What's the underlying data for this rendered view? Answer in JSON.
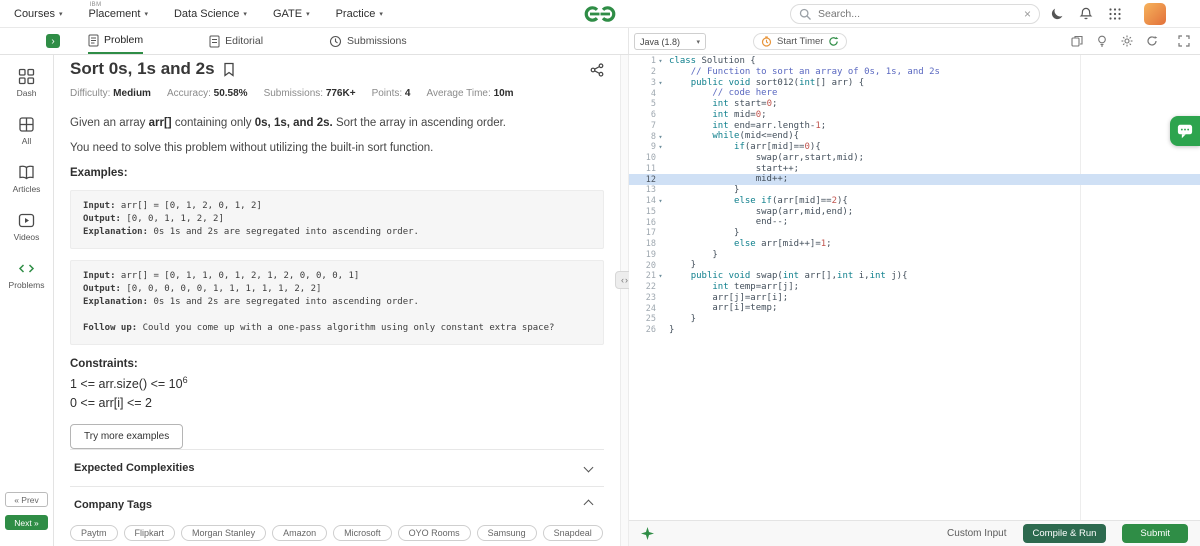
{
  "navbar": {
    "links": [
      {
        "label": "Courses"
      },
      {
        "label": "Placement",
        "badge": "IBM"
      },
      {
        "label": "Data Science"
      },
      {
        "label": "GATE"
      },
      {
        "label": "Practice"
      }
    ],
    "search": {
      "placeholder": "Search...",
      "clear": "×"
    }
  },
  "tabbar": {
    "tabs": [
      {
        "label": "Problem"
      },
      {
        "label": "Editorial"
      },
      {
        "label": "Submissions"
      }
    ],
    "language": "Java (1.8)",
    "timer_label": "Start Timer"
  },
  "siderail": {
    "items": [
      {
        "label": "Dash"
      },
      {
        "label": "All"
      },
      {
        "label": "Articles"
      },
      {
        "label": "Videos"
      },
      {
        "label": "Problems"
      }
    ],
    "prev_label": "« Prev",
    "next_label": "Next »"
  },
  "problem": {
    "title": "Sort 0s, 1s and 2s",
    "stats": [
      {
        "label": "Difficulty:",
        "value": "Medium"
      },
      {
        "label": "Accuracy:",
        "value": "50.58%"
      },
      {
        "label": "Submissions:",
        "value": "776K+"
      },
      {
        "label": "Points:",
        "value": "4"
      },
      {
        "label": "Average Time:",
        "value": "10m"
      }
    ],
    "statement": {
      "p1": "Given an array ",
      "b1": "arr[]",
      "p2": " containing only ",
      "b2": "0s, 1s, and 2s.",
      "p3": " Sort the array in ascending order."
    },
    "note": "You need to solve this problem without utilizing the built-in sort function.",
    "examples_heading": "Examples:",
    "examples": [
      {
        "input_label": "Input:",
        "input": " arr[] = [0, 1, 2, 0, 1, 2]",
        "output_label": "Output:",
        "output": " [0, 0, 1, 1, 2, 2]",
        "expl_label": "Explanation:",
        "expl": " 0s 1s and 2s are segregated into ascending order."
      },
      {
        "input_label": "Input:",
        "input": " arr[] = [0, 1, 1, 0, 1, 2, 1, 2, 0, 0, 0, 1]",
        "output_label": "Output:",
        "output": " [0, 0, 0, 0, 0, 1, 1, 1, 1, 1, 2, 2]",
        "expl_label": "Explanation:",
        "expl": " 0s 1s and 2s are segregated into ascending order.",
        "follow_label": "Follow up:",
        "follow": " Could you come up with a one-pass algorithm using only constant extra space?"
      }
    ],
    "constraints_heading": "Constraints:",
    "constraint1": {
      "text": "1 <= arr.size() <= 10",
      "sup": "6"
    },
    "constraint2": {
      "text": "0 <= arr[i] <= 2",
      "sup": ""
    },
    "try_more_label": "Try more examples",
    "sections": [
      {
        "label": "Expected Complexities"
      },
      {
        "label": "Company Tags"
      }
    ],
    "tags": [
      "Paytm",
      "Flipkart",
      "Morgan Stanley",
      "Amazon",
      "Microsoft",
      "OYO Rooms",
      "Samsung",
      "Snapdeal"
    ]
  },
  "editor": {
    "active_line": 12,
    "fold_lines": [
      1,
      3,
      8,
      9,
      14,
      21
    ],
    "lines": [
      "class Solution {",
      "    // Function to sort an array of 0s, 1s, and 2s",
      "    public void sort012(int[] arr) {",
      "        // code here",
      "        int start=0;",
      "        int mid=0;",
      "        int end=arr.length-1;",
      "        while(mid<=end){",
      "            if(arr[mid]==0){",
      "                swap(arr,start,mid);",
      "                start++;",
      "                mid++;",
      "            }",
      "            else if(arr[mid]==2){",
      "                swap(arr,mid,end);",
      "                end--;",
      "            }",
      "            else arr[mid++]=1;",
      "        }",
      "    }",
      "    public void swap(int arr[],int i,int j){",
      "        int temp=arr[j];",
      "        arr[j]=arr[i];",
      "        arr[i]=temp;",
      "    }",
      "}"
    ]
  },
  "footer": {
    "custom_input_label": "Custom Input",
    "compile_label": "Compile & Run",
    "submit_label": "Submit"
  },
  "colors": {
    "accent_green": "#2f8d46",
    "active_line_blue": "#cfe0f5"
  }
}
